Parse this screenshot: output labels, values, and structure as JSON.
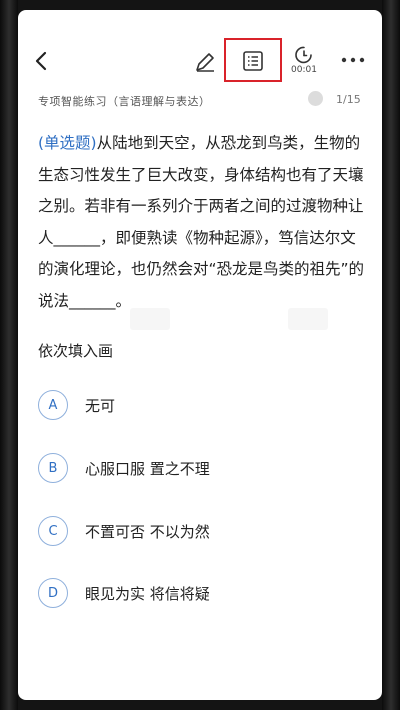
{
  "toolbar": {
    "timer": "00:01"
  },
  "header": {
    "subtitle": "专项智能练习（言语理解与表达）",
    "progress": "1/15"
  },
  "question": {
    "type_label": "(单选题)",
    "text": "从陆地到天空，从恐龙到鸟类，生物的生态习性发生了巨大改变，身体结构也有了天壤之别。若非有一系列介于两者之间的过渡物种让人______，即便熟读《物种起源》，笃信达尔文的演化理论，也仍然会对“恐龙是鸟类的祖先”的说法______。",
    "prompt": "依次填入画"
  },
  "options": [
    {
      "letter": "A",
      "text": "无可"
    },
    {
      "letter": "B",
      "text": "心服口服  置之不理"
    },
    {
      "letter": "C",
      "text": "不置可否  不以为然"
    },
    {
      "letter": "D",
      "text": "眼见为实  将信将疑"
    }
  ],
  "colors": {
    "accent": "#2f6fc3",
    "highlight_box": "#d9232a"
  },
  "icons": [
    "chevron-left-icon",
    "pencil-icon",
    "list-icon",
    "timer-icon",
    "more-icon"
  ]
}
